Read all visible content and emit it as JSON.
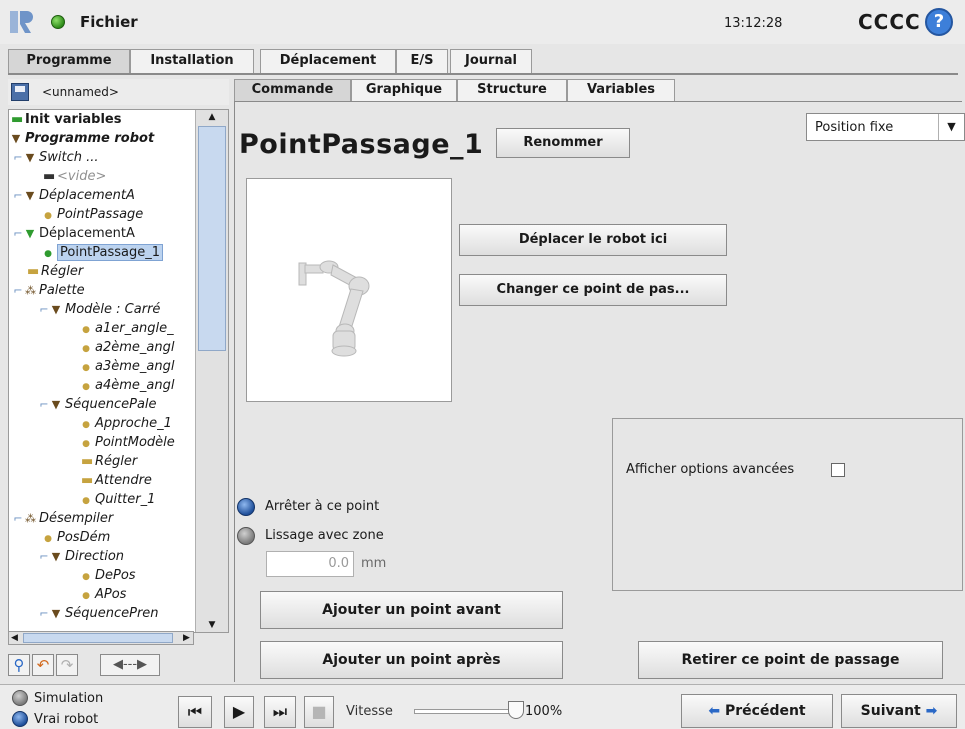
{
  "titlebar": {
    "app_menu": "Fichier",
    "time": "13:12:28",
    "robot_name": "CCCC",
    "help": "?"
  },
  "main_tabs": [
    "Programme",
    "Installation",
    "Déplacement",
    "E/S",
    "Journal"
  ],
  "program_name": "<unnamed>",
  "tree": [
    {
      "label": "Init variables"
    },
    {
      "label": "Programme robot"
    },
    {
      "label": "Switch ..."
    },
    {
      "label": "<vide>"
    },
    {
      "label": "DéplacementA"
    },
    {
      "label": "PointPassage"
    },
    {
      "label": "DéplacementA"
    },
    {
      "label": "PointPassage_1"
    },
    {
      "label": "Régler"
    },
    {
      "label": "Palette"
    },
    {
      "label": "Modèle : Carré"
    },
    {
      "label": "a1er_angle_"
    },
    {
      "label": "a2ème_angl"
    },
    {
      "label": "a3ème_angl"
    },
    {
      "label": "a4ème_angl"
    },
    {
      "label": "SéquencePale"
    },
    {
      "label": "Approche_1"
    },
    {
      "label": "PointModèle"
    },
    {
      "label": "Régler"
    },
    {
      "label": "Attendre"
    },
    {
      "label": "Quitter_1"
    },
    {
      "label": "Désempiler"
    },
    {
      "label": "PosDém"
    },
    {
      "label": "Direction"
    },
    {
      "label": "DePos"
    },
    {
      "label": "APos"
    },
    {
      "label": "SéquencePren"
    }
  ],
  "sub_tabs": [
    "Commande",
    "Graphique",
    "Structure",
    "Variables"
  ],
  "waypoint": {
    "title": "PointPassage_1",
    "rename": "Renommer",
    "position_type": "Position fixe",
    "move_robot_here": "Déplacer le robot ici",
    "change_waypoint": "Changer ce point de pas...",
    "stop_at_point": "Arrêter à ce point",
    "blend_with_radius": "Lissage avec zone",
    "blend_value": "0.0",
    "blend_unit": "mm",
    "show_advanced": "Afficher options avancées",
    "add_before": "Ajouter un point avant",
    "add_after": "Ajouter un point après",
    "remove": "Retirer ce point de passage"
  },
  "bottom": {
    "simulation": "Simulation",
    "real_robot": "Vrai robot",
    "speed_label": "Vitesse",
    "speed_value": "100%",
    "previous": "Précédent",
    "next": "Suivant"
  },
  "colors": {
    "accent_blue": "#3d7fd9",
    "status_green": "#2f8c1a",
    "selected_row": "#bcd3ef"
  }
}
